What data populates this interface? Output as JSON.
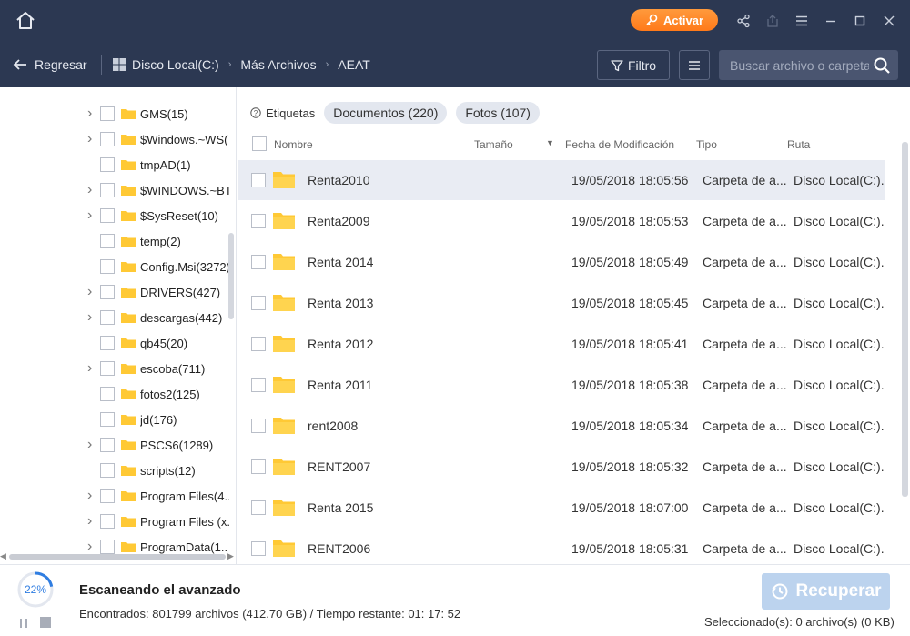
{
  "app": {
    "activate_label": "Activar"
  },
  "nav": {
    "back_label": "Regresar",
    "breadcrumbs": [
      "Disco Local(C:)",
      "Más Archivos",
      "AEAT"
    ],
    "filter_label": "Filtro",
    "search_placeholder": "Buscar archivo o carpeta"
  },
  "tree": [
    {
      "label": "GMS(15)",
      "expandable": true
    },
    {
      "label": "$Windows.~WS(",
      "expandable": true
    },
    {
      "label": "tmpAD(1)",
      "expandable": false
    },
    {
      "label": "$WINDOWS.~BT",
      "expandable": true
    },
    {
      "label": "$SysReset(10)",
      "expandable": true
    },
    {
      "label": "temp(2)",
      "expandable": false
    },
    {
      "label": "Config.Msi(3272)",
      "expandable": false
    },
    {
      "label": "DRIVERS(427)",
      "expandable": true
    },
    {
      "label": "descargas(442)",
      "expandable": true
    },
    {
      "label": "qb45(20)",
      "expandable": false
    },
    {
      "label": "escoba(711)",
      "expandable": true
    },
    {
      "label": "fotos2(125)",
      "expandable": false
    },
    {
      "label": "jd(176)",
      "expandable": false
    },
    {
      "label": "PSCS6(1289)",
      "expandable": true
    },
    {
      "label": "scripts(12)",
      "expandable": false
    },
    {
      "label": "Program Files(4..",
      "expandable": true
    },
    {
      "label": "Program Files (x..",
      "expandable": true
    },
    {
      "label": "ProgramData(1..",
      "expandable": true
    }
  ],
  "tags": {
    "label": "Etiquetas",
    "pills": [
      "Documentos (220)",
      "Fotos (107)"
    ]
  },
  "table": {
    "headers": {
      "name": "Nombre",
      "size": "Tamaño",
      "date": "Fecha de Modificación",
      "type": "Tipo",
      "path": "Ruta"
    },
    "rows": [
      {
        "name": "Renta2010",
        "size": "",
        "date": "19/05/2018 18:05:56",
        "type": "Carpeta de a...",
        "path": "Disco Local(C:)..."
      },
      {
        "name": "Renta2009",
        "size": "",
        "date": "19/05/2018 18:05:53",
        "type": "Carpeta de a...",
        "path": "Disco Local(C:)..."
      },
      {
        "name": "Renta 2014",
        "size": "",
        "date": "19/05/2018 18:05:49",
        "type": "Carpeta de a...",
        "path": "Disco Local(C:)..."
      },
      {
        "name": "Renta 2013",
        "size": "",
        "date": "19/05/2018 18:05:45",
        "type": "Carpeta de a...",
        "path": "Disco Local(C:)..."
      },
      {
        "name": "Renta 2012",
        "size": "",
        "date": "19/05/2018 18:05:41",
        "type": "Carpeta de a...",
        "path": "Disco Local(C:)..."
      },
      {
        "name": "Renta 2011",
        "size": "",
        "date": "19/05/2018 18:05:38",
        "type": "Carpeta de a...",
        "path": "Disco Local(C:)..."
      },
      {
        "name": "rent2008",
        "size": "",
        "date": "19/05/2018 18:05:34",
        "type": "Carpeta de a...",
        "path": "Disco Local(C:)..."
      },
      {
        "name": "RENT2007",
        "size": "",
        "date": "19/05/2018 18:05:32",
        "type": "Carpeta de a...",
        "path": "Disco Local(C:)..."
      },
      {
        "name": "Renta 2015",
        "size": "",
        "date": "19/05/2018 18:07:00",
        "type": "Carpeta de a...",
        "path": "Disco Local(C:)..."
      },
      {
        "name": "RENT2006",
        "size": "",
        "date": "19/05/2018 18:05:31",
        "type": "Carpeta de a...",
        "path": "Disco Local(C:)..."
      }
    ]
  },
  "footer": {
    "progress_text": "22%",
    "progress_fraction": 0.22,
    "scan_title": "Escaneando el avanzado",
    "scan_info": "Encontrados: 801799 archivos (412.70 GB) / Tiempo restante: 01: 17: 52",
    "recover_label": "Recuperar",
    "selected_text": "Seleccionado(s): 0 archivo(s) (0 KB)"
  },
  "colors": {
    "header_bg": "#2c3852",
    "accent_orange": "#ff8a2a",
    "progress_blue": "#2f7de1",
    "folder_yellow": "#ffc935"
  }
}
